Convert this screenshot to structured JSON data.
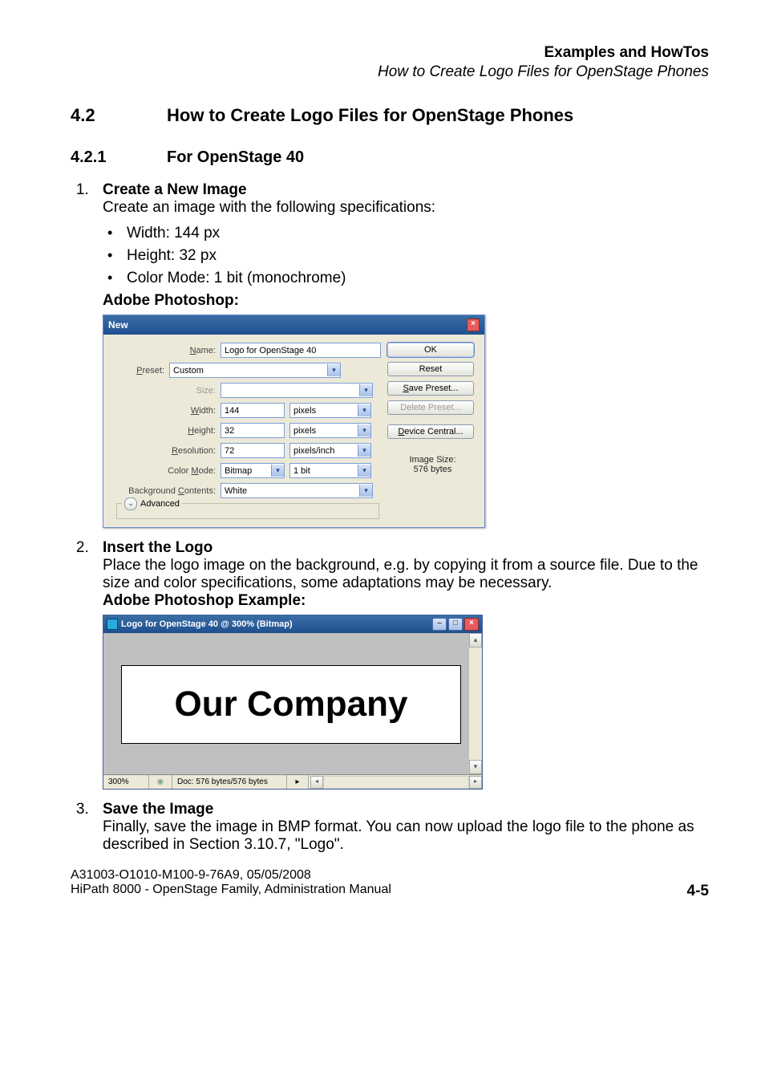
{
  "header": {
    "title": "Examples and HowTos",
    "subtitle": "How to Create Logo Files for OpenStage Phones"
  },
  "section": {
    "num": "4.2",
    "title": "How to Create Logo Files for OpenStage Phones"
  },
  "subsection": {
    "num": "4.2.1",
    "title": "For OpenStage 40"
  },
  "step1": {
    "title": "Create a New Image",
    "body": "Create an image with the following specifications:",
    "specs": {
      "w": "Width: 144 px",
      "h": "Height: 32 px",
      "c": "Color Mode: 1 bit (monochrome)"
    },
    "app": "Adobe Photoshop:"
  },
  "psnew": {
    "title": "New",
    "labels": {
      "name": "Name:",
      "preset": "Preset:",
      "size": "Size:",
      "width": "Width:",
      "height": "Height:",
      "resolution": "Resolution:",
      "colormode": "Color Mode:",
      "bg": "Background Contents:",
      "advanced": "Advanced"
    },
    "values": {
      "name": "Logo for OpenStage 40",
      "preset": "Custom",
      "size": "",
      "width": "144",
      "width_u": "pixels",
      "height": "32",
      "height_u": "pixels",
      "resolution": "72",
      "resolution_u": "pixels/inch",
      "colormode": "Bitmap",
      "depth": "1 bit",
      "bg": "White"
    },
    "buttons": {
      "ok": "OK",
      "reset": "Reset",
      "save": "Save Preset...",
      "delete": "Delete Preset...",
      "device": "Device Central..."
    },
    "imagesize_l": "Image Size:",
    "imagesize_v": "576 bytes"
  },
  "step2": {
    "title": "Insert the Logo",
    "body": "Place the logo image on the background, e.g. by copying it from a source file. Due to the size and color specifications, some adaptations may be necessary.",
    "app": "Adobe Photoshop Example:"
  },
  "pswin": {
    "title": "Logo for OpenStage 40 @ 300% (Bitmap)",
    "logo": "Our Company",
    "zoom": "300%",
    "doc": "Doc: 576 bytes/576 bytes"
  },
  "step3": {
    "title": "Save the Image",
    "body": "Finally, save the image in BMP format. You can now upload the logo file to the phone as described in Section 3.10.7, \"Logo\"."
  },
  "footer": {
    "l1": "A31003-O1010-M100-9-76A9, 05/05/2008",
    "l2": "HiPath 8000 - OpenStage Family, Administration Manual",
    "page": "4-5"
  }
}
